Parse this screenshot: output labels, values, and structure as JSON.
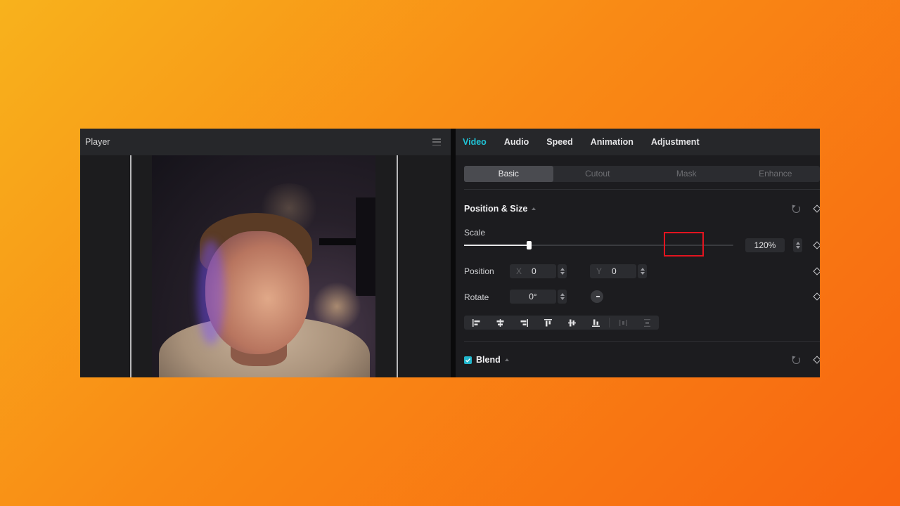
{
  "player": {
    "title": "Player",
    "menu_icon": "hamburger-menu-icon"
  },
  "panel": {
    "tabs": [
      {
        "label": "Video",
        "active": true
      },
      {
        "label": "Audio"
      },
      {
        "label": "Speed"
      },
      {
        "label": "Animation"
      },
      {
        "label": "Adjustment"
      }
    ],
    "subtabs": [
      {
        "label": "Basic",
        "active": true
      },
      {
        "label": "Cutout"
      },
      {
        "label": "Mask"
      },
      {
        "label": "Enhance"
      }
    ],
    "position_size": {
      "title": "Position & Size",
      "scale_label": "Scale",
      "scale_value": "120%",
      "scale_fraction": 0.24,
      "position_label": "Position",
      "x_prefix": "X",
      "x_value": "0",
      "y_prefix": "Y",
      "y_value": "0",
      "rotate_label": "Rotate",
      "rotate_value": "0°",
      "align_icons": [
        "align-left-icon",
        "align-center-horizontal-icon",
        "align-right-icon",
        "align-top-icon",
        "align-center-vertical-icon",
        "align-bottom-icon",
        "distribute-horizontal-icon",
        "distribute-vertical-icon"
      ]
    },
    "blend": {
      "title": "Blend",
      "checked": true
    }
  },
  "colors": {
    "accent": "#20c3d6",
    "highlight": "#e3141f",
    "background_gradient_start": "#f8b21c",
    "background_gradient_end": "#f86510"
  }
}
